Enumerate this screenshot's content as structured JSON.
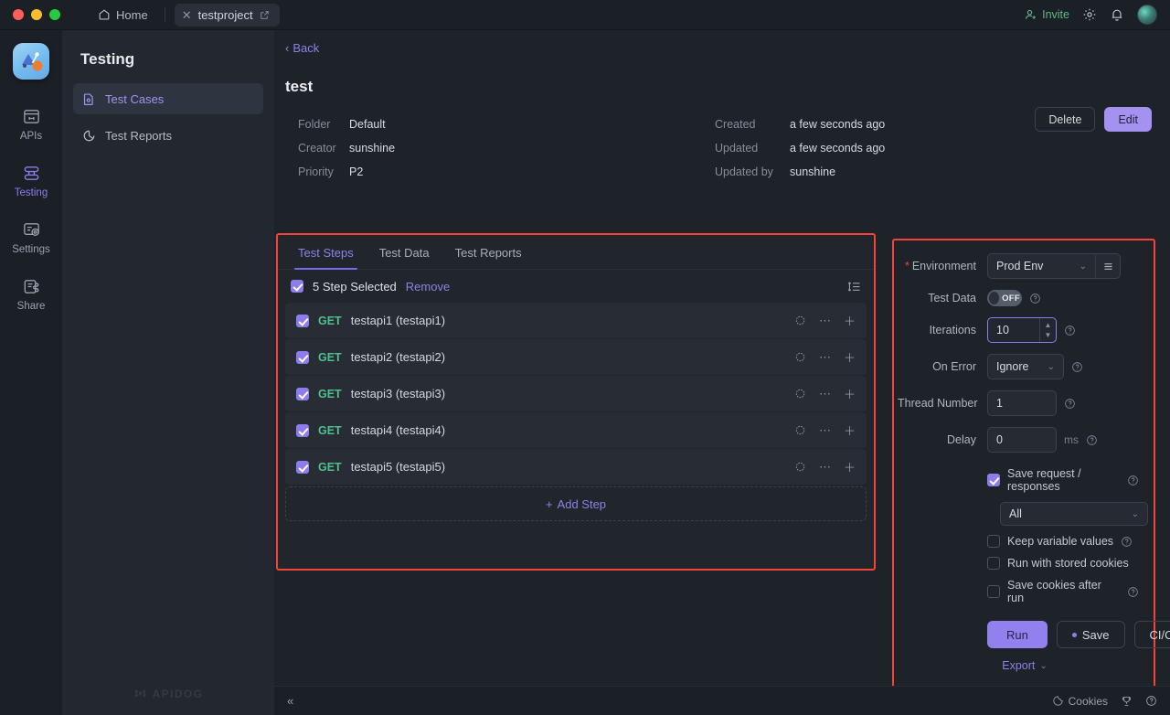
{
  "titlebar": {
    "home_label": "Home",
    "project_tab": "testproject",
    "invite_label": "Invite",
    "icons": [
      "person-add-icon",
      "gear-icon",
      "bell-icon",
      "avatar"
    ]
  },
  "rail": {
    "items": [
      {
        "label": "APIs",
        "icon": "apis-icon",
        "active": false
      },
      {
        "label": "Testing",
        "icon": "testing-icon",
        "active": true
      },
      {
        "label": "Settings",
        "icon": "settings-icon",
        "active": false
      },
      {
        "label": "Share",
        "icon": "share-icon",
        "active": false
      }
    ]
  },
  "sidebar": {
    "title": "Testing",
    "items": [
      {
        "label": "Test Cases",
        "icon": "test-case-icon",
        "active": true
      },
      {
        "label": "Test Reports",
        "icon": "pie-chart-icon",
        "active": false
      }
    ],
    "watermark": "APIDOG"
  },
  "detail": {
    "back_label": "Back",
    "title": "test",
    "delete_label": "Delete",
    "edit_label": "Edit",
    "meta_left": [
      {
        "key": "Folder",
        "value": "Default"
      },
      {
        "key": "Creator",
        "value": "sunshine"
      },
      {
        "key": "Priority",
        "value": "P2"
      }
    ],
    "meta_right": [
      {
        "key": "Created",
        "value": "a few seconds ago"
      },
      {
        "key": "Updated",
        "value": "a few seconds ago"
      },
      {
        "key": "Updated by",
        "value": "sunshine"
      }
    ]
  },
  "steps_panel": {
    "tabs": [
      {
        "label": "Test Steps",
        "active": true
      },
      {
        "label": "Test Data",
        "active": false
      },
      {
        "label": "Test Reports",
        "active": false
      }
    ],
    "selection_label": "5 Step Selected",
    "remove_label": "Remove",
    "add_step_label": "Add Step",
    "steps": [
      {
        "method": "GET",
        "name": "testapi1 (testapi1)",
        "checked": true
      },
      {
        "method": "GET",
        "name": "testapi2 (testapi2)",
        "checked": true
      },
      {
        "method": "GET",
        "name": "testapi3 (testapi3)",
        "checked": true
      },
      {
        "method": "GET",
        "name": "testapi4 (testapi4)",
        "checked": true
      },
      {
        "method": "GET",
        "name": "testapi5 (testapi5)",
        "checked": true
      }
    ]
  },
  "config": {
    "environment_label": "Environment",
    "environment_value": "Prod Env",
    "test_data_label": "Test Data",
    "test_data_state": "OFF",
    "iterations_label": "Iterations",
    "iterations_value": "10",
    "on_error_label": "On Error",
    "on_error_value": "Ignore",
    "thread_number_label": "Thread Number",
    "thread_number_value": "1",
    "delay_label": "Delay",
    "delay_value": "0",
    "delay_unit": "ms",
    "save_requests_label": "Save request / responses",
    "save_requests_checked": true,
    "save_scope_value": "All",
    "keep_variables_label": "Keep variable values",
    "keep_variables_checked": false,
    "stored_cookies_label": "Run with stored cookies",
    "stored_cookies_checked": false,
    "save_cookies_label": "Save cookies after run",
    "save_cookies_checked": false,
    "run_label": "Run",
    "save_label": "Save",
    "cicd_label": "CI/CD",
    "export_label": "Export"
  },
  "bottombar": {
    "cookies_label": "Cookies",
    "icons": [
      "collapse-icon",
      "cookie-icon",
      "trophy-icon",
      "help-icon"
    ]
  },
  "colors": {
    "accent": "#8d81e8",
    "highlight_border": "#f4443a",
    "method_get": "#4fc08d",
    "invite_green": "#5fb887"
  }
}
